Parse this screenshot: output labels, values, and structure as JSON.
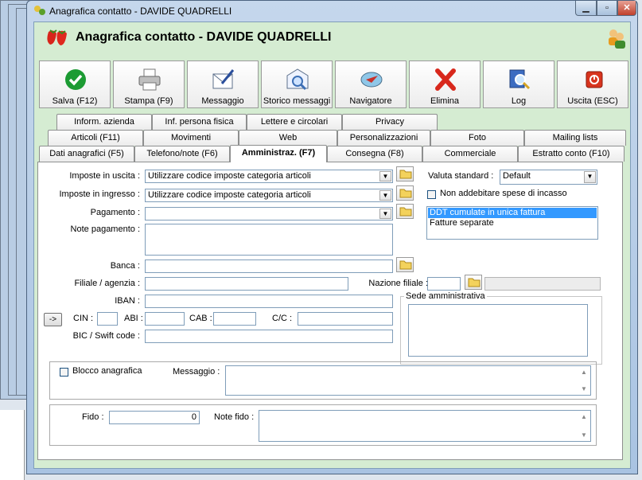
{
  "window": {
    "title": "Anagrafica contatto - DAVIDE QUADRELLI"
  },
  "header": {
    "title": "Anagrafica contatto - DAVIDE QUADRELLI"
  },
  "toolbar": [
    {
      "label": "Salva (F12)",
      "icon": "check-icon"
    },
    {
      "label": "Stampa (F9)",
      "icon": "printer-icon"
    },
    {
      "label": "Messaggio",
      "icon": "message-icon"
    },
    {
      "label": "Storico messaggi",
      "icon": "message-history-icon"
    },
    {
      "label": "Navigatore",
      "icon": "navigator-icon"
    },
    {
      "label": "Elimina",
      "icon": "delete-icon"
    },
    {
      "label": "Log",
      "icon": "log-icon"
    },
    {
      "label": "Uscita (ESC)",
      "icon": "exit-icon"
    }
  ],
  "tabs": {
    "row1": [
      "Inform. azienda",
      "Inf. persona fisica",
      "Lettere e circolari",
      "Privacy"
    ],
    "row2": [
      "Articoli (F11)",
      "Movimenti",
      "Web",
      "Personalizzazioni",
      "Foto",
      "Mailing lists"
    ],
    "row3": [
      "Dati anagrafici (F5)",
      "Telefono/note (F6)",
      "Amministraz. (F7)",
      "Consegna (F8)",
      "Commerciale",
      "Estratto conto (F10)"
    ],
    "active": "Amministraz. (F7)"
  },
  "form": {
    "imposte_uscita_label": "Imposte in uscita :",
    "imposte_uscita_value": "Utilizzare codice imposte categoria articoli",
    "imposte_ingresso_label": "Imposte in ingresso :",
    "imposte_ingresso_value": "Utilizzare codice imposte categoria articoli",
    "pagamento_label": "Pagamento :",
    "pagamento_value": "",
    "note_pagamento_label": "Note pagamento :",
    "banca_label": "Banca :",
    "filiale_label": "Filiale / agenzia :",
    "nazione_filiale_label": "Nazione filiale :",
    "iban_label": "IBAN :",
    "arrow_button": "->",
    "cin_label": "CIN :",
    "abi_label": "ABI :",
    "cab_label": "CAB :",
    "cc_label": "C/C :",
    "bic_label": "BIC / Swift code :",
    "valuta_label": "Valuta standard :",
    "valuta_value": "Default",
    "non_addebitare_label": "Non addebitare spese di incasso",
    "fatturazione_options": [
      "DDT cumulate in unica fattura",
      "Fatture separate"
    ],
    "fatturazione_selected": "DDT cumulate in unica fattura",
    "sede_label": "Sede amministrativa",
    "blocco_label": "Blocco anagrafica",
    "messaggio_label": "Messaggio :",
    "fido_label": "Fido :",
    "fido_value": "0",
    "note_fido_label": "Note fido :"
  },
  "colors": {
    "client_bg": "#d5ecd2",
    "selection": "#3399ff"
  }
}
